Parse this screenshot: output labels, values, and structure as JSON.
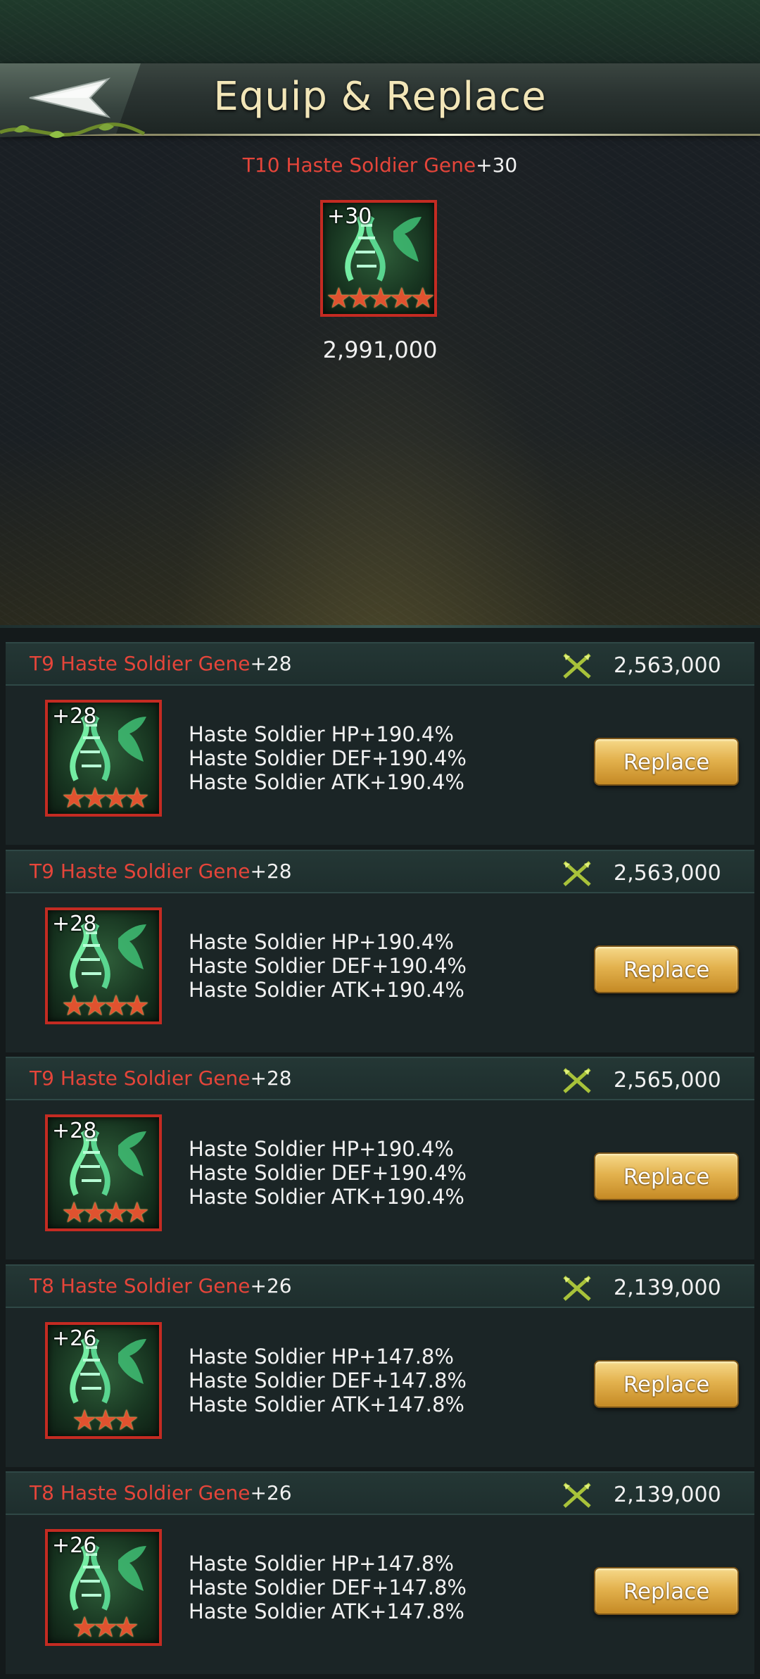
{
  "header": {
    "title": "Equip & Replace"
  },
  "current": {
    "name_red": "T10 Haste Soldier Gene",
    "name_level": "+30",
    "icon_level": "+30",
    "stars": "★★★★★",
    "power": "2,991,000"
  },
  "items": [
    {
      "name_red": "T9 Haste Soldier Gene",
      "name_level": "+28",
      "power": "2,563,000",
      "icon_level": "+28",
      "stars": "★★★★",
      "stats": [
        "Haste Soldier HP+190.4%",
        "Haste Soldier DEF+190.4%",
        "Haste Soldier ATK+190.4%"
      ],
      "button": "Replace"
    },
    {
      "name_red": "T9 Haste Soldier Gene",
      "name_level": "+28",
      "power": "2,563,000",
      "icon_level": "+28",
      "stars": "★★★★",
      "stats": [
        "Haste Soldier HP+190.4%",
        "Haste Soldier DEF+190.4%",
        "Haste Soldier ATK+190.4%"
      ],
      "button": "Replace"
    },
    {
      "name_red": "T9 Haste Soldier Gene",
      "name_level": "+28",
      "power": "2,565,000",
      "icon_level": "+28",
      "stars": "★★★★",
      "stats": [
        "Haste Soldier HP+190.4%",
        "Haste Soldier DEF+190.4%",
        "Haste Soldier ATK+190.4%"
      ],
      "button": "Replace"
    },
    {
      "name_red": "T8 Haste Soldier Gene",
      "name_level": "+26",
      "power": "2,139,000",
      "icon_level": "+26",
      "stars": "★★★",
      "stats": [
        "Haste Soldier HP+147.8%",
        "Haste Soldier DEF+147.8%",
        "Haste Soldier ATK+147.8%"
      ],
      "button": "Replace"
    },
    {
      "name_red": "T8 Haste Soldier Gene",
      "name_level": "+26",
      "power": "2,139,000",
      "icon_level": "+26",
      "stars": "★★★",
      "stats": [
        "Haste Soldier HP+147.8%",
        "Haste Soldier DEF+147.8%",
        "Haste Soldier ATK+147.8%"
      ],
      "button": "Replace"
    }
  ]
}
